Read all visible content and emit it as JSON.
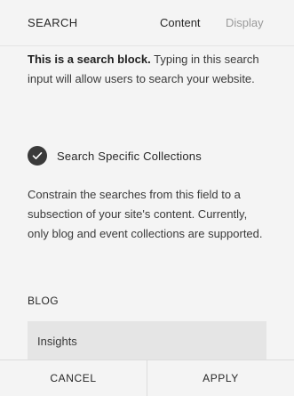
{
  "header": {
    "title": "SEARCH",
    "tabs": [
      {
        "label": "Content",
        "active": true
      },
      {
        "label": "Display",
        "active": false
      }
    ]
  },
  "intro": {
    "bold": "This is a search block.",
    "text": " Typing in this search input will allow users to search your website."
  },
  "search_specific": {
    "label": "Search Specific Collections",
    "checked": true,
    "icon": "checkmark-icon"
  },
  "constrain_text": "Constrain the searches from this field to a subsection of your site's content. Currently, only blog and event collections are supported.",
  "blog_section": {
    "label": "BLOG",
    "items": [
      "Insights"
    ]
  },
  "footer": {
    "cancel_label": "CANCEL",
    "apply_label": "APPLY"
  },
  "colors": {
    "background": "#f4f4f4",
    "item_background": "#e5e5e5",
    "check_fill": "#3a3a3a",
    "inactive_tab": "#9a9a9a"
  }
}
